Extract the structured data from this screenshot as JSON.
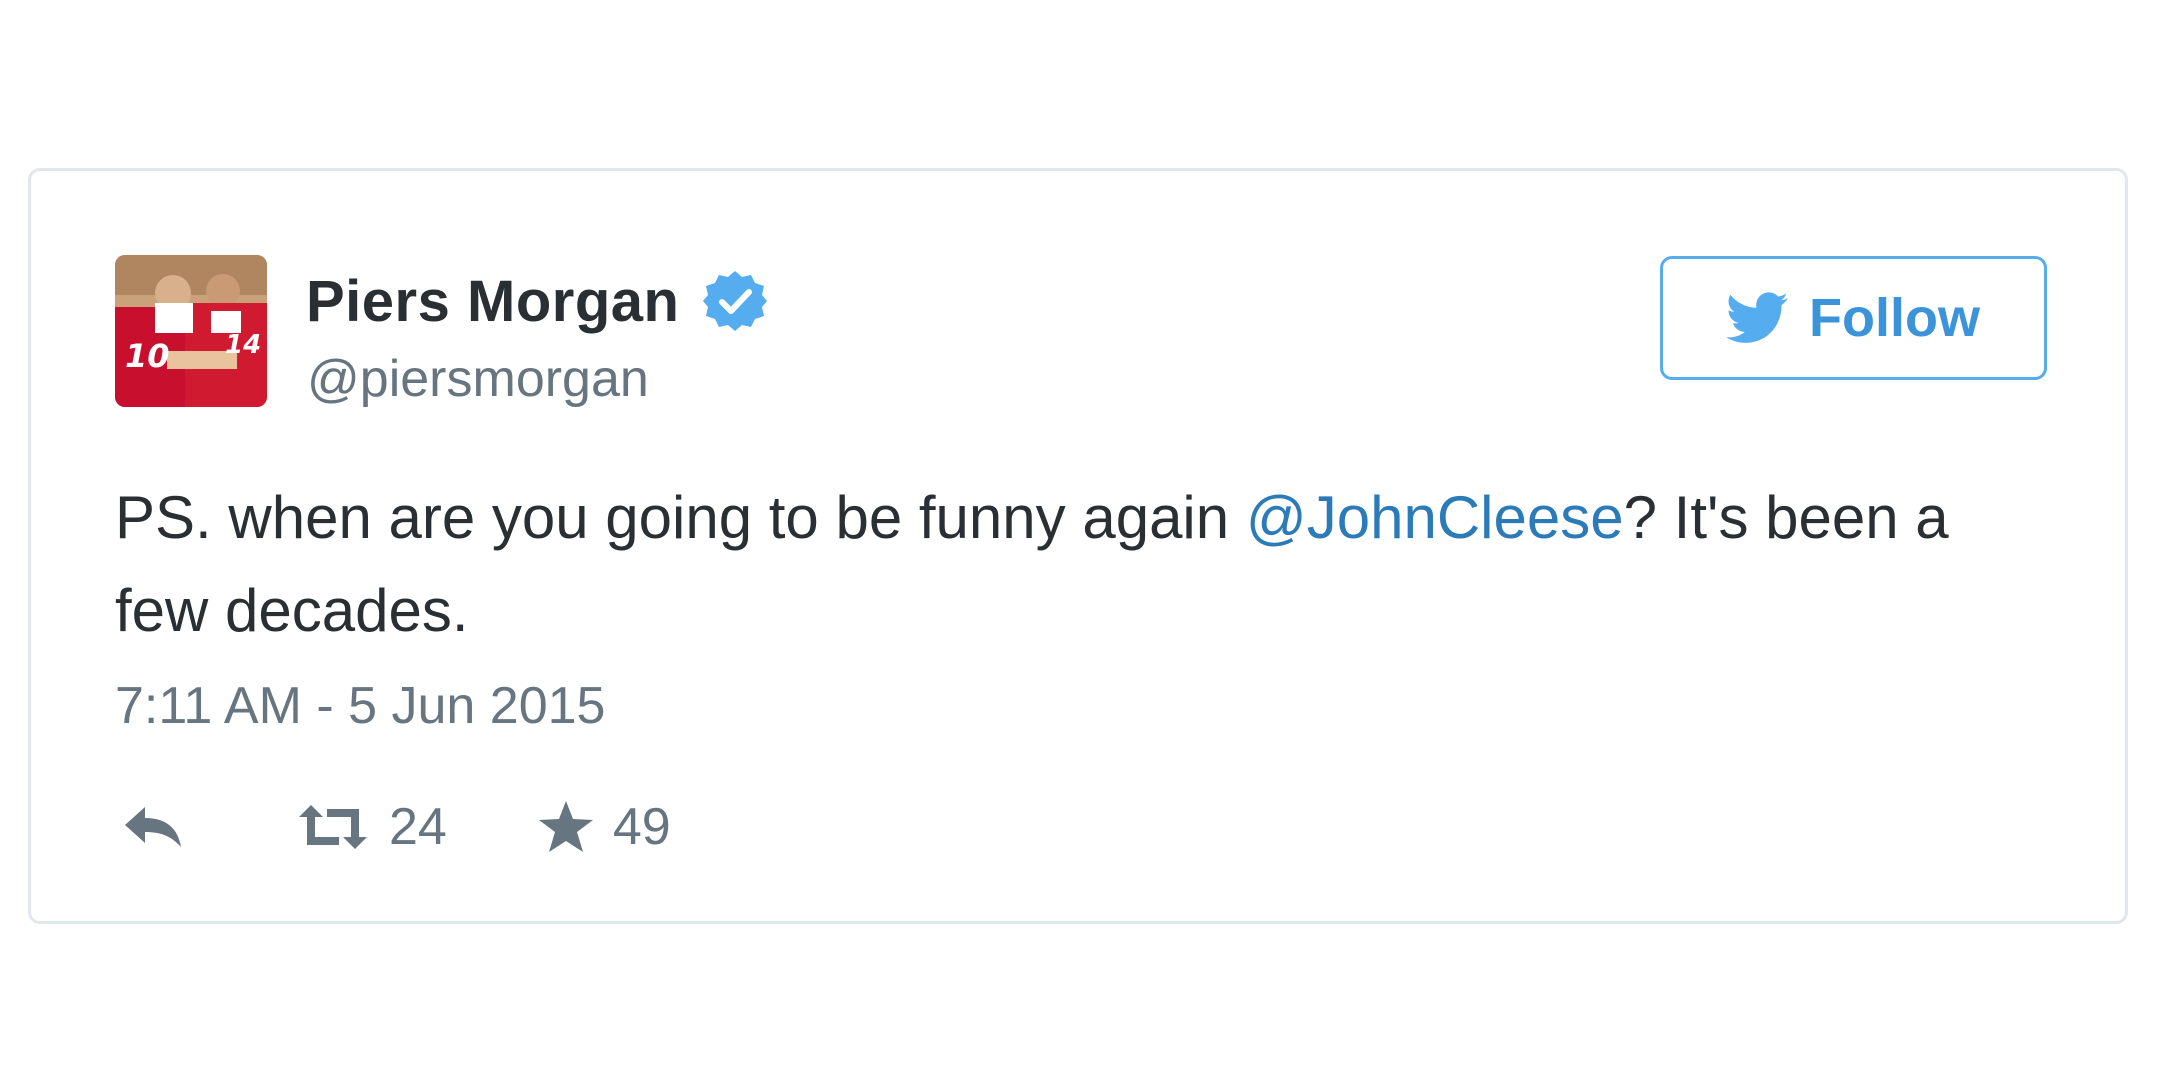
{
  "tweet": {
    "author": {
      "display_name": "Piers Morgan",
      "screen_name": "@piersmorgan",
      "verified": true,
      "avatar_jersey_numbers": [
        "10",
        "14"
      ]
    },
    "follow_label": "Follow",
    "text_before_mention": "PS. when are you going to be funny again ",
    "mention": "@JohnCleese",
    "text_after_mention": "? It's been a few decades.",
    "timestamp": "7:11 AM - 5 Jun 2015",
    "actions": {
      "reply_icon": "reply-icon",
      "retweet_icon": "retweet-icon",
      "retweet_count": "24",
      "favorite_icon": "star-icon",
      "favorite_count": "49"
    }
  },
  "colors": {
    "text": "#292f33",
    "secondary_text": "#66757f",
    "link": "#2b7bb9",
    "twitter_blue": "#55acee",
    "card_border": "#e1e8ed",
    "verified_badge": "#55acee"
  }
}
